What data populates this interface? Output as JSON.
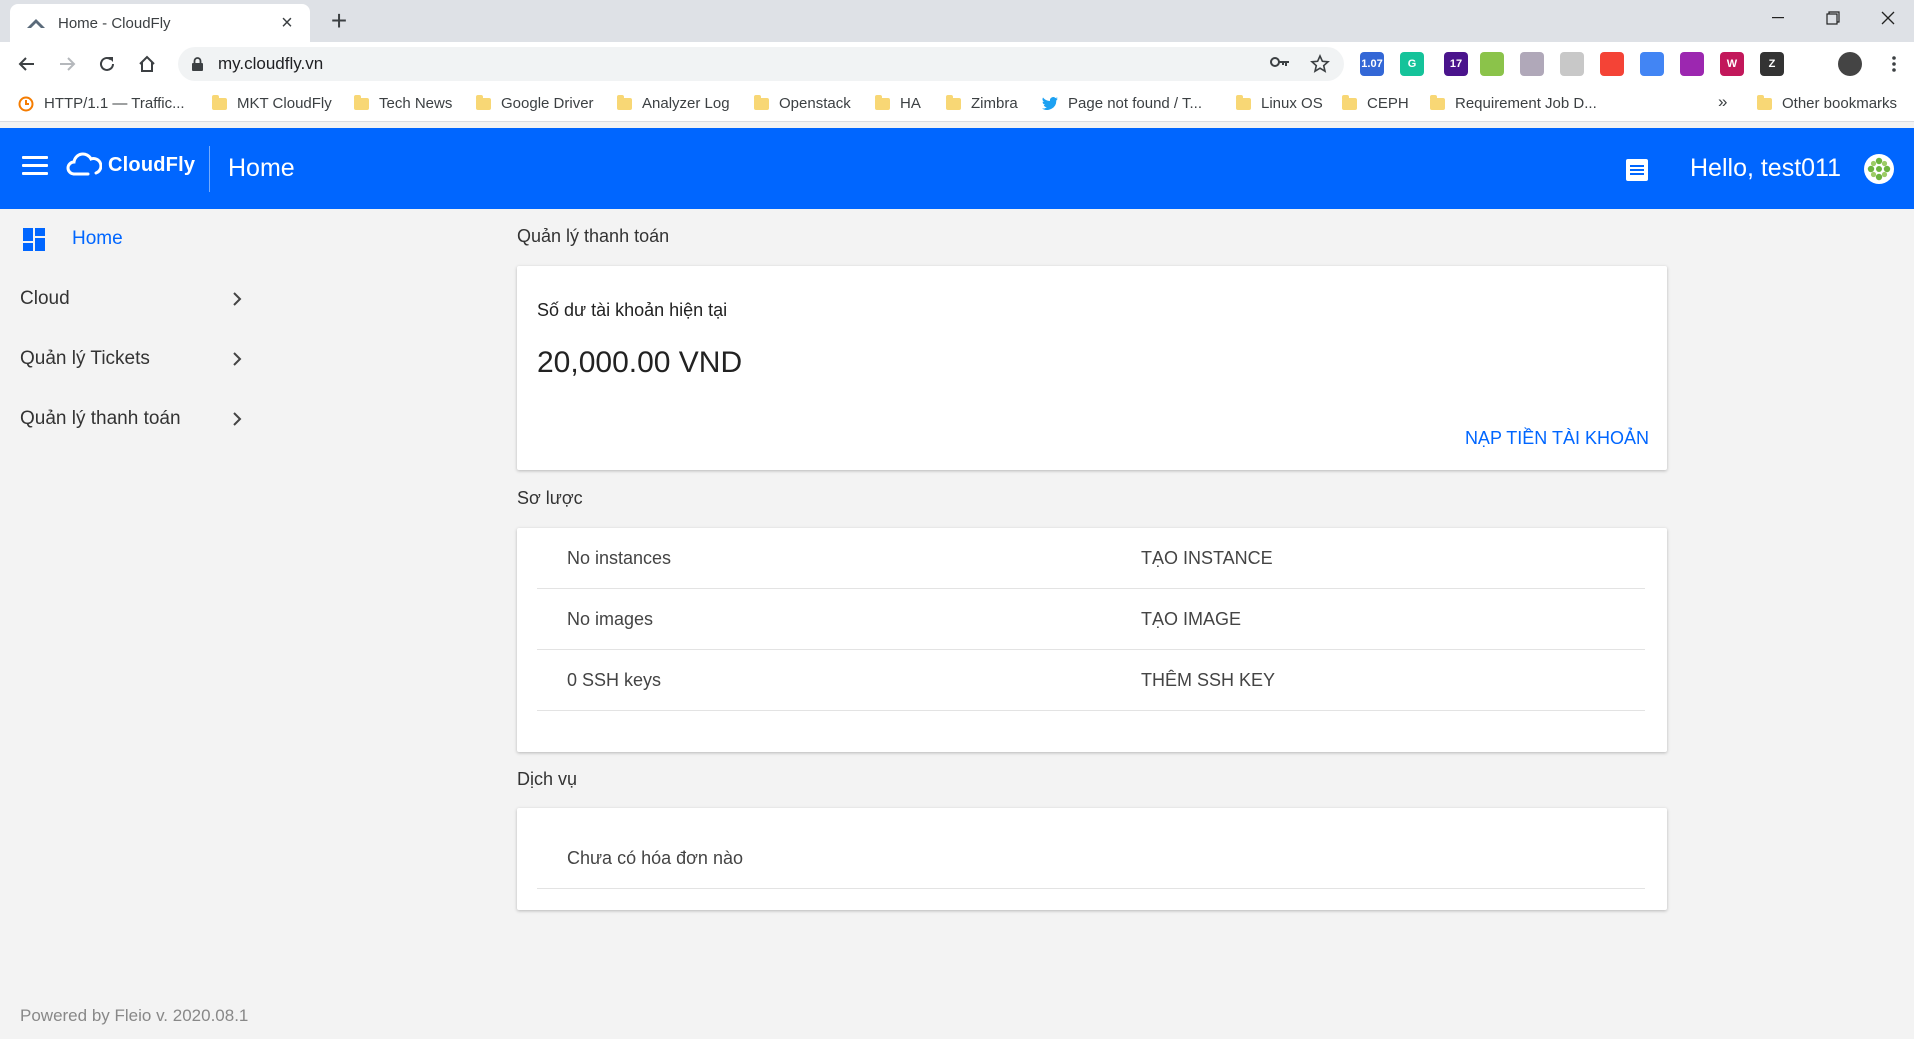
{
  "browser": {
    "tab_title": "Home - CloudFly",
    "url": "my.cloudfly.vn",
    "extensions": [
      {
        "name": "speed-extension-icon",
        "text": "1.07",
        "color": "#3367d6"
      },
      {
        "name": "grammarly-icon",
        "text": "G",
        "color": "#15c39a"
      },
      {
        "name": "graduation-extension-icon",
        "text": "17",
        "color": "#4a148c"
      },
      {
        "name": "parrot-extension-icon",
        "text": "",
        "color": "#8bc34a"
      },
      {
        "name": "window-extension-icon",
        "text": "",
        "color": "#b0a8b9"
      },
      {
        "name": "bolt-extension-icon",
        "text": "",
        "color": "#c8c8c8"
      },
      {
        "name": "color-grid-extension-icon",
        "text": "",
        "color": "#f44336"
      },
      {
        "name": "translate-extension-icon",
        "text": "",
        "color": "#4285f4"
      },
      {
        "name": "pdf-extension-icon",
        "text": "",
        "color": "#9c27b0"
      },
      {
        "name": "w-extension-icon",
        "text": "W",
        "color": "#c2185b"
      },
      {
        "name": "zoom-extension-icon",
        "text": "Z",
        "color": "#333333"
      },
      {
        "name": "puzzle-extensions-icon",
        "text": "",
        "color": "#5f6368"
      },
      {
        "name": "profile-avatar-icon",
        "text": "",
        "color": "#444444"
      }
    ],
    "bookmarks": [
      {
        "label": "HTTP/1.1 — Traffic...",
        "type": "site"
      },
      {
        "label": "MKT CloudFly",
        "type": "folder"
      },
      {
        "label": "Tech News",
        "type": "folder"
      },
      {
        "label": "Google Driver",
        "type": "folder"
      },
      {
        "label": "Analyzer Log",
        "type": "folder"
      },
      {
        "label": "Openstack",
        "type": "folder"
      },
      {
        "label": "HA",
        "type": "folder"
      },
      {
        "label": "Zimbra",
        "type": "folder"
      },
      {
        "label": "Page not found / T...",
        "type": "twitter"
      },
      {
        "label": "Linux OS",
        "type": "folder"
      },
      {
        "label": "CEPH",
        "type": "folder"
      },
      {
        "label": "Requirement Job D...",
        "type": "folder"
      }
    ],
    "more_bookmarks": "»",
    "other_bookmarks": "Other bookmarks"
  },
  "appbar": {
    "brand": "CloudFly",
    "title": "Home",
    "greeting": "Hello, test011"
  },
  "sidebar": {
    "items": [
      {
        "label": "Home"
      },
      {
        "label": "Cloud"
      },
      {
        "label": "Quản lý Tickets"
      },
      {
        "label": "Quản lý thanh toán"
      }
    ],
    "footer": "Powered by Fleio v. 2020.08.1"
  },
  "billing": {
    "section_title": "Quản lý thanh toán",
    "balance_label": "Số dư tài khoản hiện tại",
    "balance_value": "20,000.00 VND",
    "topup_label": "NẠP TIỀN TÀI KHOẢN"
  },
  "overview": {
    "section_title": "Sơ lược",
    "rows": [
      {
        "left": "No instances",
        "right": "TẠO INSTANCE"
      },
      {
        "left": "No images",
        "right": "TẠO IMAGE"
      },
      {
        "left": "0 SSH keys",
        "right": "THÊM SSH KEY"
      }
    ]
  },
  "services": {
    "section_title": "Dịch vụ",
    "empty_text": "Chưa có hóa đơn nào"
  },
  "colors": {
    "brand_blue": "#0066ff",
    "page_bg": "#f3f3f3"
  }
}
